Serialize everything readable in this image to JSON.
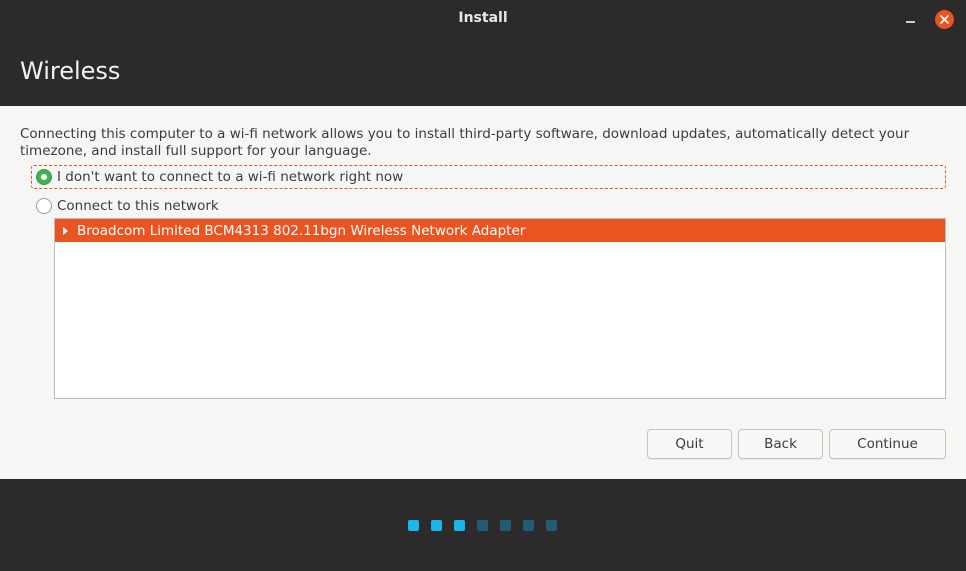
{
  "window": {
    "title": "Install"
  },
  "header": {
    "page_title": "Wireless"
  },
  "content": {
    "description": "Connecting this computer to a wi-fi network allows you to install third-party software, download updates, automatically detect your timezone, and install full support for your language.",
    "options": [
      {
        "label": "I don't want to connect to a wi-fi network right now",
        "selected": true
      },
      {
        "label": "Connect to this network",
        "selected": false
      }
    ],
    "networks": [
      {
        "label": "Broadcom Limited BCM4313 802.11bgn Wireless Network Adapter",
        "expanded": false,
        "selected": true
      }
    ]
  },
  "buttons": {
    "quit": "Quit",
    "back": "Back",
    "continue": "Continue"
  },
  "progress": {
    "total_steps": 7,
    "completed_steps": 3
  },
  "colors": {
    "accent": "#e95420",
    "radio_checked": "#3eb34f",
    "progress_done": "#19b6ee",
    "progress_todo": "#205d74",
    "chrome_bg": "#2c2a2a",
    "content_bg": "#f6f6f5"
  },
  "icons": {
    "minimize": "minimize-icon",
    "close": "close-icon",
    "expander": "triangle-right-icon"
  }
}
